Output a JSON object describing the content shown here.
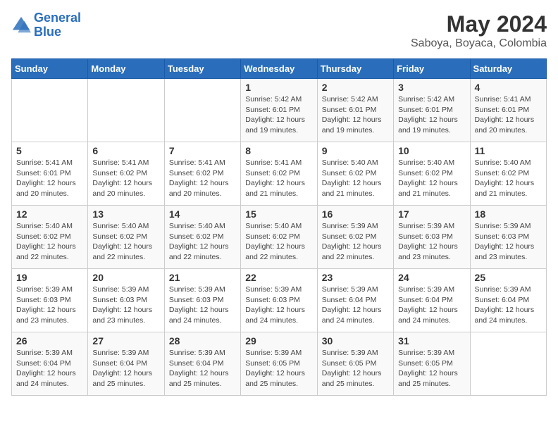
{
  "logo": {
    "line1": "General",
    "line2": "Blue"
  },
  "title": "May 2024",
  "subtitle": "Saboya, Boyaca, Colombia",
  "weekdays": [
    "Sunday",
    "Monday",
    "Tuesday",
    "Wednesday",
    "Thursday",
    "Friday",
    "Saturday"
  ],
  "weeks": [
    [
      {
        "day": "",
        "content": ""
      },
      {
        "day": "",
        "content": ""
      },
      {
        "day": "",
        "content": ""
      },
      {
        "day": "1",
        "content": "Sunrise: 5:42 AM\nSunset: 6:01 PM\nDaylight: 12 hours\nand 19 minutes."
      },
      {
        "day": "2",
        "content": "Sunrise: 5:42 AM\nSunset: 6:01 PM\nDaylight: 12 hours\nand 19 minutes."
      },
      {
        "day": "3",
        "content": "Sunrise: 5:42 AM\nSunset: 6:01 PM\nDaylight: 12 hours\nand 19 minutes."
      },
      {
        "day": "4",
        "content": "Sunrise: 5:41 AM\nSunset: 6:01 PM\nDaylight: 12 hours\nand 20 minutes."
      }
    ],
    [
      {
        "day": "5",
        "content": "Sunrise: 5:41 AM\nSunset: 6:01 PM\nDaylight: 12 hours\nand 20 minutes."
      },
      {
        "day": "6",
        "content": "Sunrise: 5:41 AM\nSunset: 6:02 PM\nDaylight: 12 hours\nand 20 minutes."
      },
      {
        "day": "7",
        "content": "Sunrise: 5:41 AM\nSunset: 6:02 PM\nDaylight: 12 hours\nand 20 minutes."
      },
      {
        "day": "8",
        "content": "Sunrise: 5:41 AM\nSunset: 6:02 PM\nDaylight: 12 hours\nand 21 minutes."
      },
      {
        "day": "9",
        "content": "Sunrise: 5:40 AM\nSunset: 6:02 PM\nDaylight: 12 hours\nand 21 minutes."
      },
      {
        "day": "10",
        "content": "Sunrise: 5:40 AM\nSunset: 6:02 PM\nDaylight: 12 hours\nand 21 minutes."
      },
      {
        "day": "11",
        "content": "Sunrise: 5:40 AM\nSunset: 6:02 PM\nDaylight: 12 hours\nand 21 minutes."
      }
    ],
    [
      {
        "day": "12",
        "content": "Sunrise: 5:40 AM\nSunset: 6:02 PM\nDaylight: 12 hours\nand 22 minutes."
      },
      {
        "day": "13",
        "content": "Sunrise: 5:40 AM\nSunset: 6:02 PM\nDaylight: 12 hours\nand 22 minutes."
      },
      {
        "day": "14",
        "content": "Sunrise: 5:40 AM\nSunset: 6:02 PM\nDaylight: 12 hours\nand 22 minutes."
      },
      {
        "day": "15",
        "content": "Sunrise: 5:40 AM\nSunset: 6:02 PM\nDaylight: 12 hours\nand 22 minutes."
      },
      {
        "day": "16",
        "content": "Sunrise: 5:39 AM\nSunset: 6:02 PM\nDaylight: 12 hours\nand 22 minutes."
      },
      {
        "day": "17",
        "content": "Sunrise: 5:39 AM\nSunset: 6:03 PM\nDaylight: 12 hours\nand 23 minutes."
      },
      {
        "day": "18",
        "content": "Sunrise: 5:39 AM\nSunset: 6:03 PM\nDaylight: 12 hours\nand 23 minutes."
      }
    ],
    [
      {
        "day": "19",
        "content": "Sunrise: 5:39 AM\nSunset: 6:03 PM\nDaylight: 12 hours\nand 23 minutes."
      },
      {
        "day": "20",
        "content": "Sunrise: 5:39 AM\nSunset: 6:03 PM\nDaylight: 12 hours\nand 23 minutes."
      },
      {
        "day": "21",
        "content": "Sunrise: 5:39 AM\nSunset: 6:03 PM\nDaylight: 12 hours\nand 24 minutes."
      },
      {
        "day": "22",
        "content": "Sunrise: 5:39 AM\nSunset: 6:03 PM\nDaylight: 12 hours\nand 24 minutes."
      },
      {
        "day": "23",
        "content": "Sunrise: 5:39 AM\nSunset: 6:04 PM\nDaylight: 12 hours\nand 24 minutes."
      },
      {
        "day": "24",
        "content": "Sunrise: 5:39 AM\nSunset: 6:04 PM\nDaylight: 12 hours\nand 24 minutes."
      },
      {
        "day": "25",
        "content": "Sunrise: 5:39 AM\nSunset: 6:04 PM\nDaylight: 12 hours\nand 24 minutes."
      }
    ],
    [
      {
        "day": "26",
        "content": "Sunrise: 5:39 AM\nSunset: 6:04 PM\nDaylight: 12 hours\nand 24 minutes."
      },
      {
        "day": "27",
        "content": "Sunrise: 5:39 AM\nSunset: 6:04 PM\nDaylight: 12 hours\nand 25 minutes."
      },
      {
        "day": "28",
        "content": "Sunrise: 5:39 AM\nSunset: 6:04 PM\nDaylight: 12 hours\nand 25 minutes."
      },
      {
        "day": "29",
        "content": "Sunrise: 5:39 AM\nSunset: 6:05 PM\nDaylight: 12 hours\nand 25 minutes."
      },
      {
        "day": "30",
        "content": "Sunrise: 5:39 AM\nSunset: 6:05 PM\nDaylight: 12 hours\nand 25 minutes."
      },
      {
        "day": "31",
        "content": "Sunrise: 5:39 AM\nSunset: 6:05 PM\nDaylight: 12 hours\nand 25 minutes."
      },
      {
        "day": "",
        "content": ""
      }
    ]
  ]
}
